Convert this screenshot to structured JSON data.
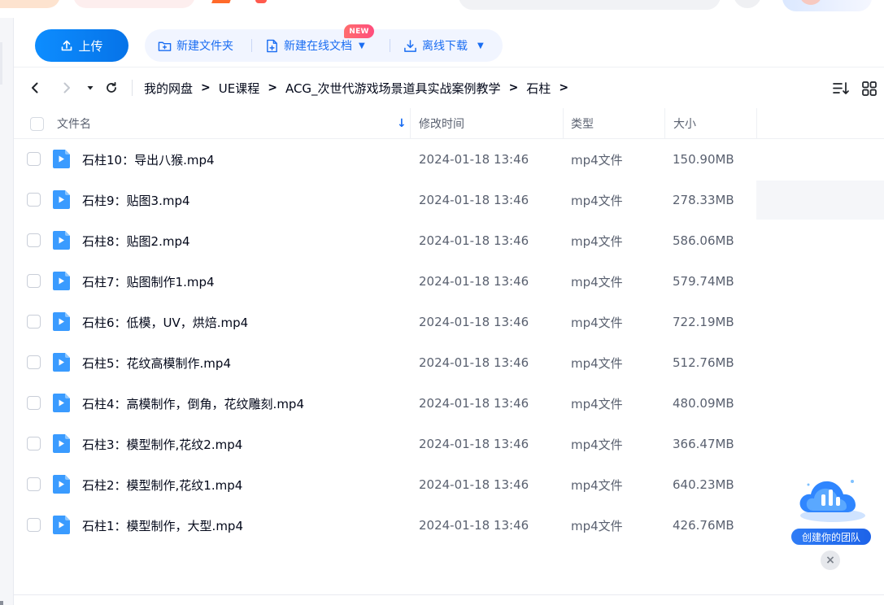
{
  "toolbar": {
    "upload_label": "上传",
    "new_folder_label": "新建文件夹",
    "new_online_doc_label": "新建在线文档",
    "new_badge": "NEW",
    "offline_download_label": "离线下载"
  },
  "breadcrumb": [
    "我的网盘",
    "UE课程",
    "ACG_次世代游戏场景道具实战案例教学",
    "石柱"
  ],
  "table": {
    "columns": {
      "name": "文件名",
      "modified": "修改时间",
      "type": "类型",
      "size": "大小"
    },
    "rows": [
      {
        "name": "石柱10：导出八猴.mp4",
        "modified": "2024-01-18 13:46",
        "type": "mp4文件",
        "size": "150.90MB"
      },
      {
        "name": "石柱9：贴图3.mp4",
        "modified": "2024-01-18 13:46",
        "type": "mp4文件",
        "size": "278.33MB"
      },
      {
        "name": "石柱8：贴图2.mp4",
        "modified": "2024-01-18 13:46",
        "type": "mp4文件",
        "size": "586.06MB"
      },
      {
        "name": "石柱7：贴图制作1.mp4",
        "modified": "2024-01-18 13:46",
        "type": "mp4文件",
        "size": "579.74MB"
      },
      {
        "name": "石柱6：低模，UV，烘焙.mp4",
        "modified": "2024-01-18 13:46",
        "type": "mp4文件",
        "size": "722.19MB"
      },
      {
        "name": "石柱5：花纹高模制作.mp4",
        "modified": "2024-01-18 13:46",
        "type": "mp4文件",
        "size": "512.76MB"
      },
      {
        "name": "石柱4：高模制作，倒角，花纹雕刻.mp4",
        "modified": "2024-01-18 13:46",
        "type": "mp4文件",
        "size": "480.09MB"
      },
      {
        "name": "石柱3：模型制作,花纹2.mp4",
        "modified": "2024-01-18 13:46",
        "type": "mp4文件",
        "size": "366.47MB"
      },
      {
        "name": "石柱2：模型制作,花纹1.mp4",
        "modified": "2024-01-18 13:46",
        "type": "mp4文件",
        "size": "640.23MB"
      },
      {
        "name": "石柱1：模型制作，大型.mp4",
        "modified": "2024-01-18 13:46",
        "type": "mp4文件",
        "size": "426.76MB"
      }
    ]
  },
  "widget": {
    "team_label": "创建你的团队"
  },
  "colors": {
    "accent": "#0673e8",
    "link_blue": "#1a6df2",
    "video_icon": "#3a9bff"
  }
}
